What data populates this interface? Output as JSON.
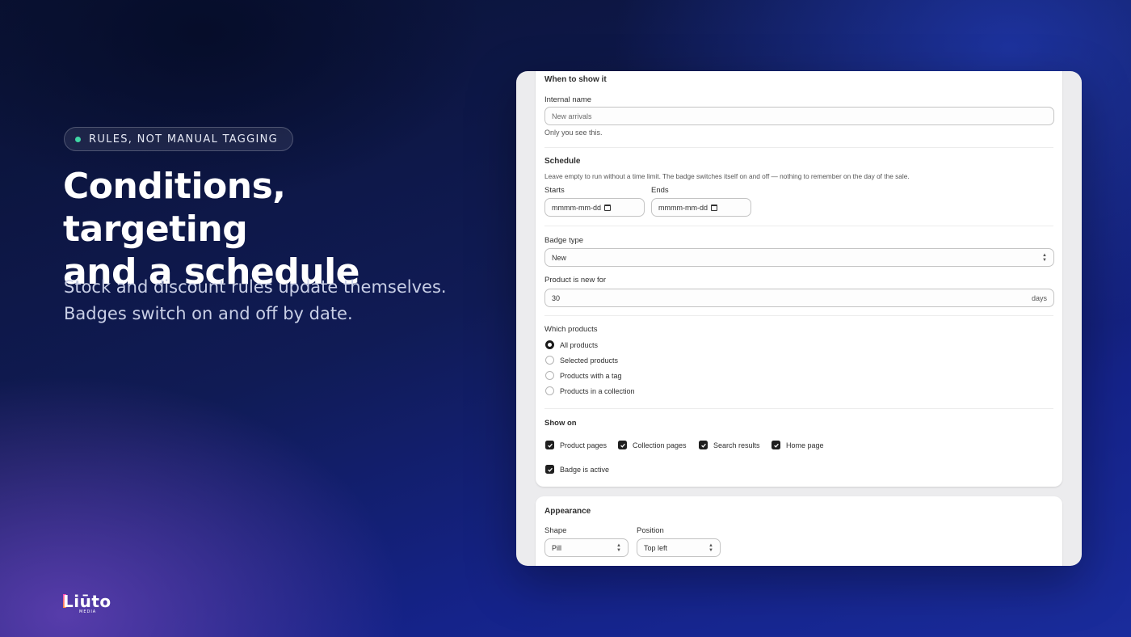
{
  "hero": {
    "eyebrow": "RULES, NOT MANUAL TAGGING",
    "headline_line1": "Conditions, targeting",
    "headline_line2": "and a schedule",
    "sub_line1": "Stock and discount rules update themselves.",
    "sub_line2": "Badges switch on and off by date."
  },
  "brand": {
    "name": "Liūto",
    "tagline": "MEDIA"
  },
  "form": {
    "section_when": "When to show it",
    "internal_name_label": "Internal name",
    "internal_name_placeholder": "New arrivals",
    "internal_name_help": "Only you see this.",
    "schedule_title": "Schedule",
    "schedule_help": "Leave empty to run without a time limit. The badge switches itself on and off — nothing to remember on the day of the sale.",
    "starts_label": "Starts",
    "starts_placeholder": "mmmm-mm-dd",
    "ends_label": "Ends",
    "ends_placeholder": "mmmm-mm-dd",
    "badge_type_label": "Badge type",
    "badge_type_value": "New",
    "new_for_label": "Product is new for",
    "new_for_value": "30",
    "new_for_suffix": "days",
    "which_products_label": "Which products",
    "product_options": [
      {
        "label": "All products",
        "selected": true
      },
      {
        "label": "Selected products",
        "selected": false
      },
      {
        "label": "Products with a tag",
        "selected": false
      },
      {
        "label": "Products in a collection",
        "selected": false
      }
    ],
    "show_on_title": "Show on",
    "show_on_options": [
      {
        "label": "Product pages",
        "checked": true
      },
      {
        "label": "Collection pages",
        "checked": true
      },
      {
        "label": "Search results",
        "checked": true
      },
      {
        "label": "Home page",
        "checked": true
      }
    ],
    "active_label": "Badge is active",
    "active_checked": true
  },
  "appearance": {
    "title": "Appearance",
    "shape_label": "Shape",
    "shape_value": "Pill",
    "position_label": "Position",
    "position_value": "Top left"
  },
  "colors": {
    "accent_dot": "#3fd6a4",
    "check_fill": "#1f1f1f"
  }
}
